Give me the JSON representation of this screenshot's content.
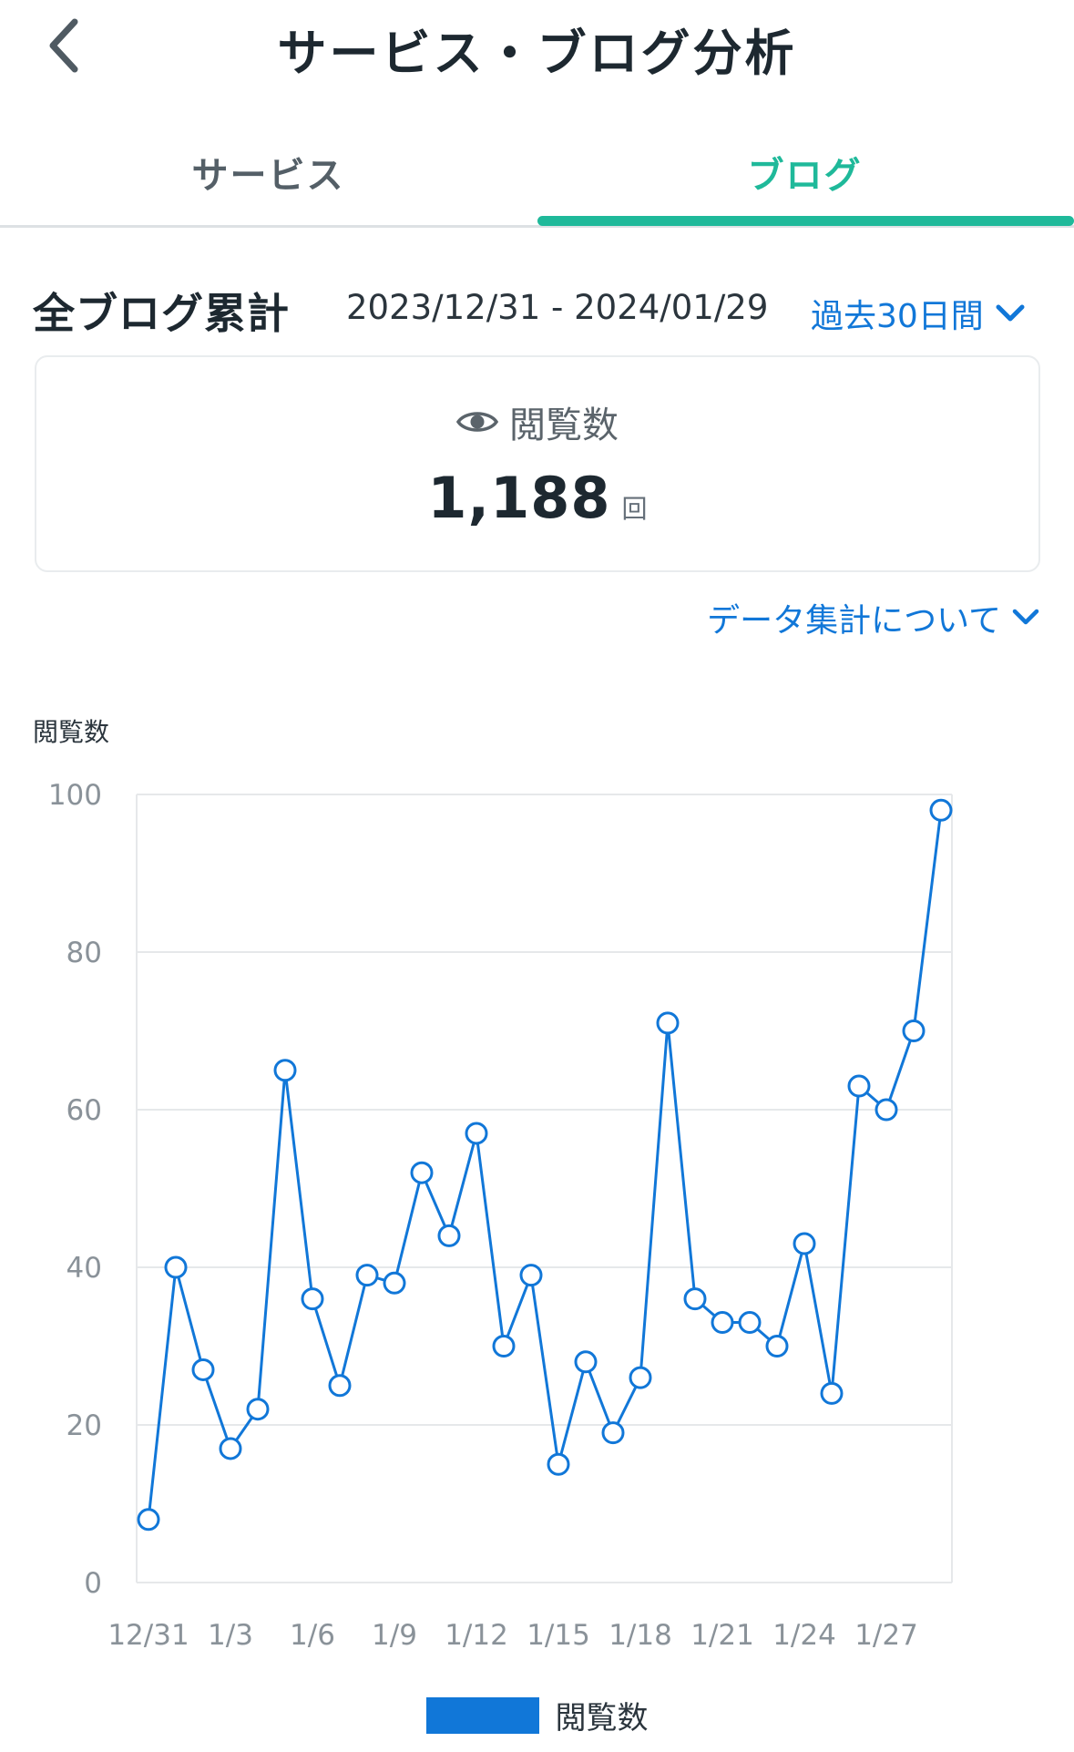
{
  "header": {
    "title": "サービス・ブログ分析",
    "back_icon": "chevron-left-icon"
  },
  "tabs": [
    {
      "label": "サービス",
      "active": false
    },
    {
      "label": "ブログ",
      "active": true
    }
  ],
  "summary": {
    "title": "全ブログ累計",
    "date_range": "2023/12/31 - 2024/01/29",
    "period": "過去30日間"
  },
  "stat_card": {
    "icon": "eye-icon",
    "label": "閲覧数",
    "value": "1,188",
    "unit": "回"
  },
  "about_link": "データ集計について",
  "colors": {
    "accent_blue": "#1177d8",
    "accent_green": "#1fb99a",
    "chart_line": "#1177d8"
  },
  "chart_data": {
    "type": "line",
    "ylabel": "閲覧数",
    "ylim": [
      0,
      100
    ],
    "y_ticks": [
      "0",
      "20",
      "40",
      "60",
      "80",
      "100"
    ],
    "x_tick_labels": [
      "12/31",
      "1/3",
      "1/6",
      "1/9",
      "1/12",
      "1/15",
      "1/18",
      "1/21",
      "1/24",
      "1/27"
    ],
    "series": [
      {
        "name": "閲覧数",
        "values": [
          8,
          40,
          27,
          17,
          22,
          65,
          36,
          25,
          39,
          38,
          52,
          44,
          57,
          30,
          39,
          15,
          28,
          19,
          26,
          71,
          36,
          33,
          33,
          30,
          43,
          24,
          63,
          60,
          70,
          98
        ]
      }
    ],
    "grid": true,
    "legend": "bottom-center"
  }
}
